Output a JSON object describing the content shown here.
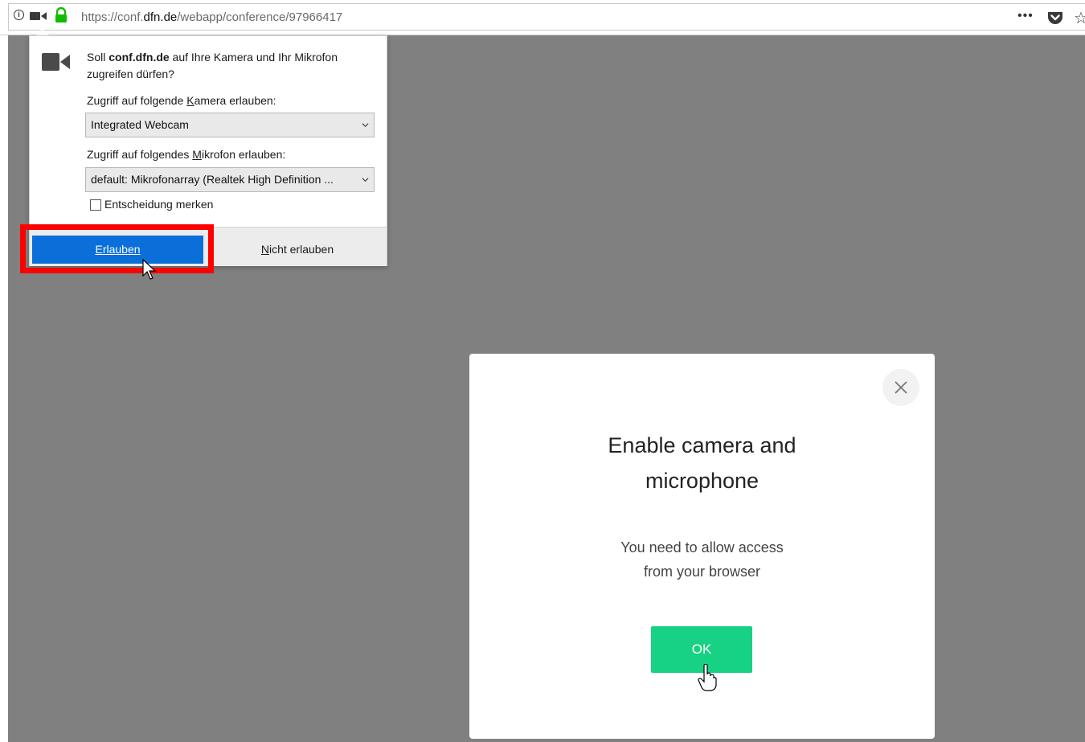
{
  "browser": {
    "url_prefix": "https://conf.",
    "url_host": "dfn.de",
    "url_path": "/webapp/conference/97966417",
    "info_glyph": "i",
    "more_glyph": "•••",
    "star_glyph": "☆"
  },
  "permission": {
    "question_pre": "Soll ",
    "question_host": "conf.dfn.de",
    "question_post": " auf Ihre Kamera und Ihr Mikrofon zugreifen dürfen?",
    "camera_label_pre": "Zugriff auf folgende ",
    "camera_label_key": "K",
    "camera_label_post": "amera erlauben:",
    "camera_value": "Integrated Webcam",
    "mic_label_pre": "Zugriff auf folgendes ",
    "mic_label_key": "M",
    "mic_label_post": "ikrofon erlauben:",
    "mic_value": "default: Mikrofonarray (Realtek High Definition ...",
    "remember_label": "Entscheidung merken",
    "allow_key": "E",
    "allow_rest": "rlauben",
    "deny_key": "N",
    "deny_rest": "icht erlauben"
  },
  "modal": {
    "title_line1": "Enable camera and",
    "title_line2": "microphone",
    "sub_line1": "You need to allow access",
    "sub_line2": "from your browser",
    "ok_label": "OK"
  },
  "colors": {
    "allow_button": "#0a6fd9",
    "ok_button": "#17d184",
    "highlight": "#ff0000",
    "backdrop": "#808080"
  }
}
